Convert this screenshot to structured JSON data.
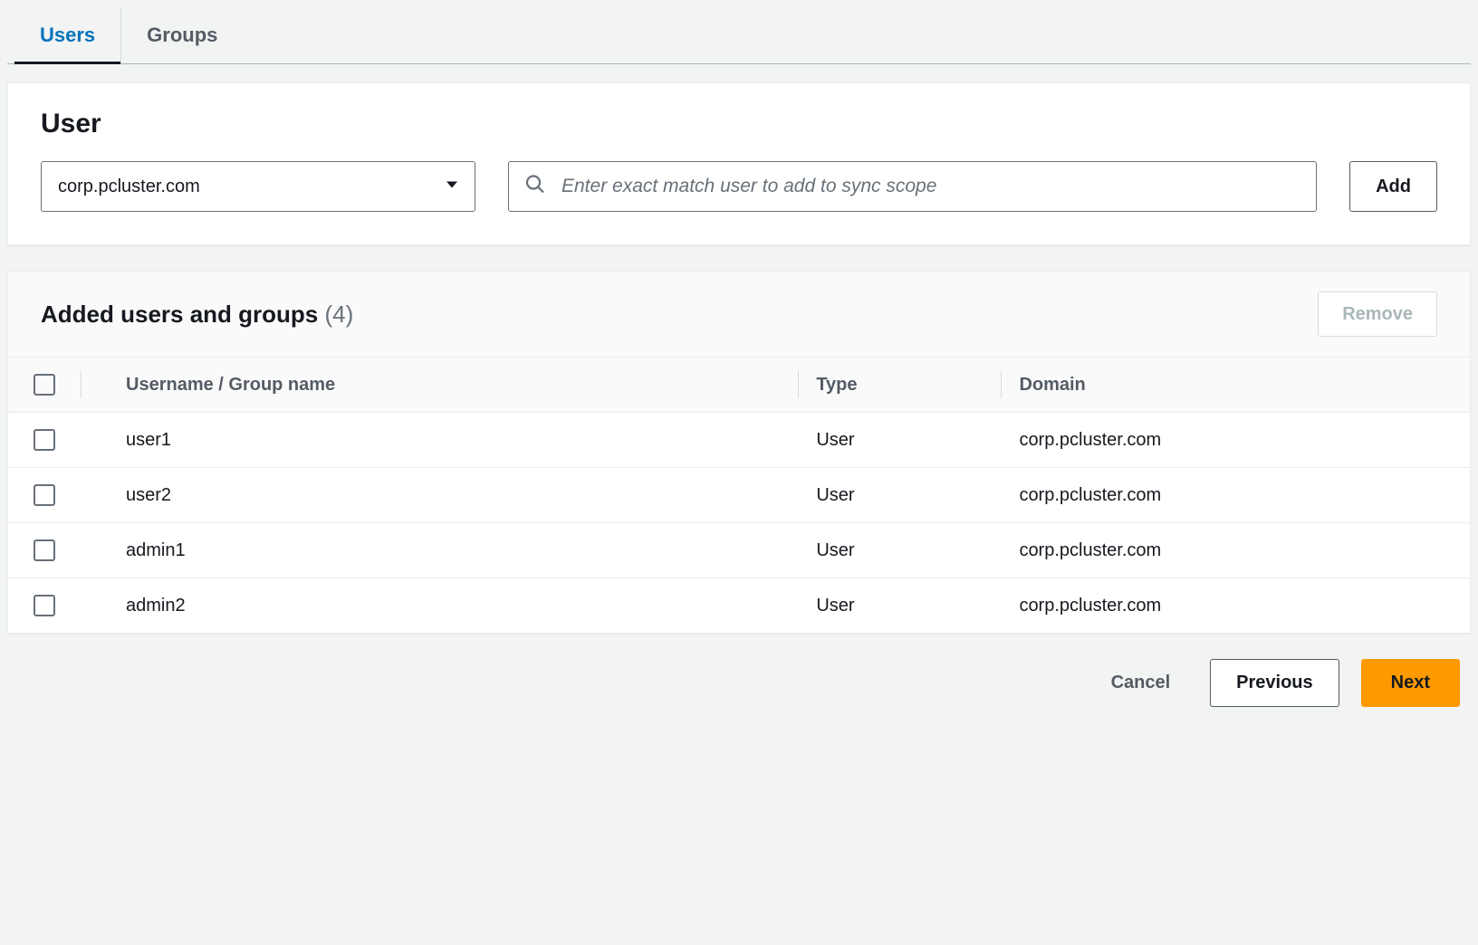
{
  "tabs": {
    "users": "Users",
    "groups": "Groups"
  },
  "user_panel": {
    "title": "User",
    "domain_value": "corp.pcluster.com",
    "search_placeholder": "Enter exact match user to add to sync scope",
    "add_label": "Add"
  },
  "table_panel": {
    "title": "Added users and groups",
    "count_label": "(4)",
    "remove_label": "Remove",
    "columns": {
      "name": "Username / Group name",
      "type": "Type",
      "domain": "Domain"
    },
    "rows": [
      {
        "name": "user1",
        "type": "User",
        "domain": "corp.pcluster.com"
      },
      {
        "name": "user2",
        "type": "User",
        "domain": "corp.pcluster.com"
      },
      {
        "name": "admin1",
        "type": "User",
        "domain": "corp.pcluster.com"
      },
      {
        "name": "admin2",
        "type": "User",
        "domain": "corp.pcluster.com"
      }
    ]
  },
  "footer": {
    "cancel": "Cancel",
    "previous": "Previous",
    "next": "Next"
  }
}
